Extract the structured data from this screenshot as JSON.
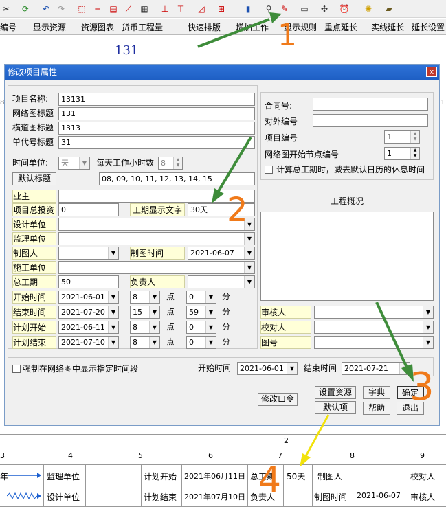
{
  "toolbar": {
    "icons": [
      "cut-icon",
      "sync-icon",
      "undo-icon",
      "redo-icon",
      "select-icon",
      "line-icon",
      "node-icon",
      "curve-icon",
      "clipboard-icon",
      "split-icon",
      "merge-icon",
      "calc-icon",
      "align-icon",
      "bar-chart-icon",
      "resource-icon",
      "edit-property-icon",
      "screen-icon",
      "bug-icon",
      "alarm-icon",
      "bulb-icon",
      "suitcase-icon"
    ]
  },
  "menu": {
    "items": [
      "编号",
      "显示资源",
      "资源图表",
      "货币工程量",
      "快速排版",
      "增加工作",
      "显示规则",
      "重点延长",
      "实线延长",
      "延长设置"
    ]
  },
  "canvas": {
    "number": "131",
    "ruler": [
      "8",
      "1"
    ]
  },
  "dialog": {
    "title": "修改项目属性",
    "close": "x",
    "labels": {
      "project_name": "项目名称:",
      "network_title": "网络图标题",
      "gantt_title": "横道图标题",
      "code_title": "单代号标题",
      "time_unit": "时间单位:",
      "daily_hours": "每天工作小时数",
      "default_title": "默认标题",
      "owner": "业主",
      "total_investment": "项目总投资",
      "duration_text": "工期显示文字",
      "design_unit": "设计单位",
      "supervision_unit": "监理单位",
      "drafter": "制图人",
      "draw_time": "制图时间",
      "construction_unit": "施工单位",
      "total_duration": "总工期",
      "responsible": "负责人",
      "start_time": "开始时间",
      "end_time": "结束时间",
      "plan_start": "计划开始",
      "plan_end": "计划结束",
      "dian": "点",
      "fen": "分",
      "contract_no": "合同号:",
      "external_no": "对外编号",
      "project_no": "项目编号",
      "start_node_no": "网络图开始节点编号",
      "deduct_rest": "计算总工期时，减去默认日历的休息时间",
      "overview": "工程概况",
      "reviewer": "审核人",
      "checker": "校对人",
      "drawing_no": "图号",
      "force_show": "强制在网络图中显示指定时间段",
      "range_start": "开始时间",
      "range_end": "结束时间"
    },
    "values": {
      "project_name": "13131",
      "network_title": "131",
      "gantt_title": "1313",
      "code_title": "31",
      "time_unit": "天",
      "daily_hours": "8",
      "hours_list": "08, 09, 10, 11, 12, 13, 14, 15",
      "total_investment": "0",
      "duration_text": "30天",
      "draw_time": "2021-06-07",
      "total_duration": "50",
      "start_date": "2021-06-01",
      "start_hour": "8",
      "start_min": "0",
      "end_date": "2021-07-20",
      "end_hour": "15",
      "end_min": "59",
      "plan_start_date": "2021-06-11",
      "plan_start_hour": "8",
      "plan_start_min": "0",
      "plan_end_date": "2021-07-10",
      "plan_end_hour": "8",
      "plan_end_min": "0",
      "project_no": "1",
      "start_node_no": "1",
      "range_start": "2021-06-01",
      "range_end": "2021-07-21"
    },
    "buttons": {
      "change_password": "修改口令",
      "set_resource": "设置资源",
      "dictionary": "字典",
      "ok": "确定",
      "default": "默认项",
      "help": "帮助",
      "exit": "退出"
    }
  },
  "annotations": {
    "n1": "1",
    "n2": "2",
    "n3": "3",
    "n4": "4"
  },
  "bottom": {
    "top_label": "2",
    "scale": [
      "3",
      "4",
      "5",
      "6",
      "7",
      "8",
      "9"
    ],
    "row1": {
      "legend": "年",
      "supervision": "监理单位",
      "plan_start": "计划开始",
      "plan_start_val": "2021年06月11日",
      "total": "总工期",
      "total_val": "50天",
      "drafter": "制图人",
      "checker": "校对人"
    },
    "row2": {
      "design": "设计单位",
      "plan_end": "计划结束",
      "plan_end_val": "2021年07月10日",
      "responsible": "负责人",
      "draw_time": "制图时间",
      "draw_time_val": "2021-06-07",
      "reviewer": "审核人"
    }
  },
  "colors": {
    "annotation_orange": "#f07a1a",
    "arrow_green": "#3e8c3a",
    "arrow_yellow": "#f2e20c",
    "title_blue": "#2f73d8",
    "canvas_number": "#1e2ea0"
  }
}
